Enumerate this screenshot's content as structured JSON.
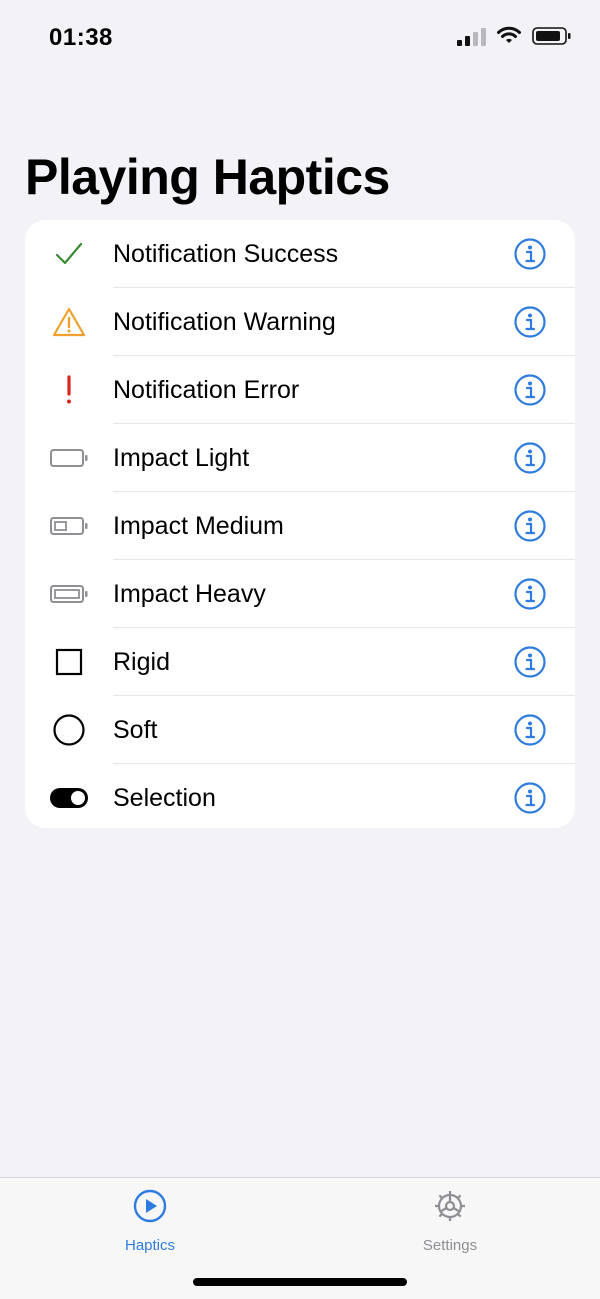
{
  "status_bar": {
    "time": "01:38"
  },
  "page": {
    "title": "Playing Haptics"
  },
  "items": [
    {
      "label": "Notification Success",
      "icon": "checkmark-icon",
      "color": "#3a8a33"
    },
    {
      "label": "Notification Warning",
      "icon": "warning-triangle-icon",
      "color": "#f0a02c"
    },
    {
      "label": "Notification Error",
      "icon": "exclamation-icon",
      "color": "#d9261c"
    },
    {
      "label": "Impact Light",
      "icon": "battery-empty-icon",
      "color": "#8e8e93"
    },
    {
      "label": "Impact Medium",
      "icon": "battery-quarter-icon",
      "color": "#8e8e93"
    },
    {
      "label": "Impact Heavy",
      "icon": "battery-full-icon",
      "color": "#8e8e93"
    },
    {
      "label": "Rigid",
      "icon": "square-icon",
      "color": "#000000"
    },
    {
      "label": "Soft",
      "icon": "circle-icon",
      "color": "#000000"
    },
    {
      "label": "Selection",
      "icon": "toggle-icon",
      "color": "#000000"
    }
  ],
  "tabs": [
    {
      "label": "Haptics",
      "icon": "play-circle-icon",
      "selected": true
    },
    {
      "label": "Settings",
      "icon": "gear-icon",
      "selected": false
    }
  ],
  "colors": {
    "accent": "#2f7ce0",
    "inactive": "#8e8e93",
    "background": "#f2f2f7"
  }
}
